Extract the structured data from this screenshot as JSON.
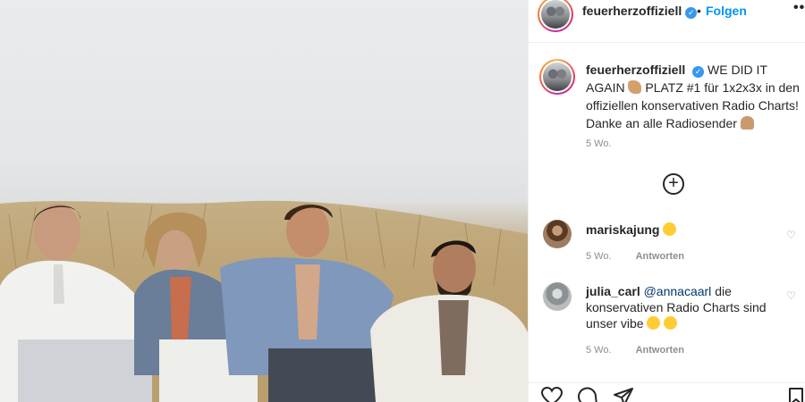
{
  "post": {
    "username": "feuerherzoffiziell",
    "separator": "•",
    "follow_label": "Folgen",
    "more_label": "•••",
    "verified_mark": "✓",
    "photo_icon": "group-photo-dunes",
    "caption_user": "feuerherzoffiziell",
    "caption_line1": "WE DID IT AGAIN",
    "caption_line2": "PLATZ #1 für 1x2x3x in den offiziellen konservativen Radio Charts! Danke an alle Radiosender",
    "caption_time": "5 Wo.",
    "load_more_label": "+"
  },
  "comments": [
    {
      "user": "mariskajung",
      "text": "",
      "time": "5 Wo.",
      "reply_label": "Antworten"
    },
    {
      "user": "julia_carl",
      "mention": "@annacaarl",
      "text": "die konservativen Radio Charts sind unser vibe",
      "time": "5 Wo.",
      "reply_label": "Antworten"
    }
  ],
  "actions": {
    "like_icon": "heart-icon",
    "comment_icon": "comment-icon",
    "share_icon": "share-icon",
    "save_icon": "bookmark-icon"
  },
  "colors": {
    "accent": "#0095f6",
    "verified": "#3897f0",
    "muted": "#8e8e8e",
    "text": "#262626"
  }
}
